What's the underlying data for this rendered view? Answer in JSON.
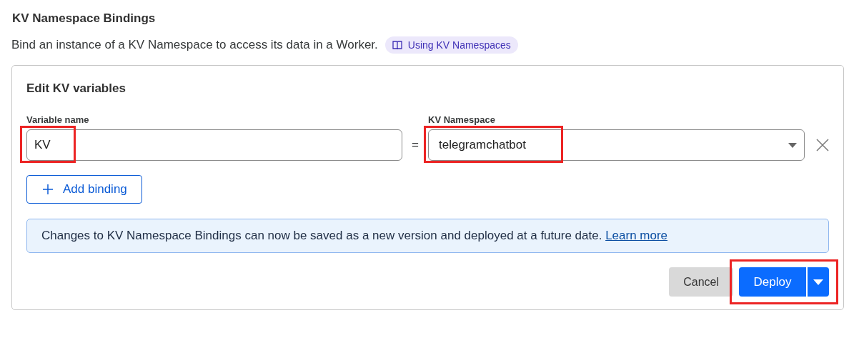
{
  "section": {
    "title": "KV Namespace Bindings",
    "description": "Bind an instance of a KV Namespace to access its data in a Worker.",
    "doc_link": "Using KV Namespaces"
  },
  "card": {
    "title": "Edit KV variables",
    "binding": {
      "variable_label": "Variable name",
      "variable_value": "KV",
      "variable_highlighted": true,
      "equals": "=",
      "namespace_label": "KV Namespace",
      "namespace_value": "telegramchatbot",
      "namespace_highlighted": true
    },
    "add_button": "Add binding",
    "notice": {
      "text": "Changes to KV Namespace Bindings can now be saved as a new version and deployed at a future date.",
      "link": "Learn more"
    },
    "cancel_button": "Cancel",
    "deploy_button": "Deploy",
    "deploy_highlighted": true
  }
}
